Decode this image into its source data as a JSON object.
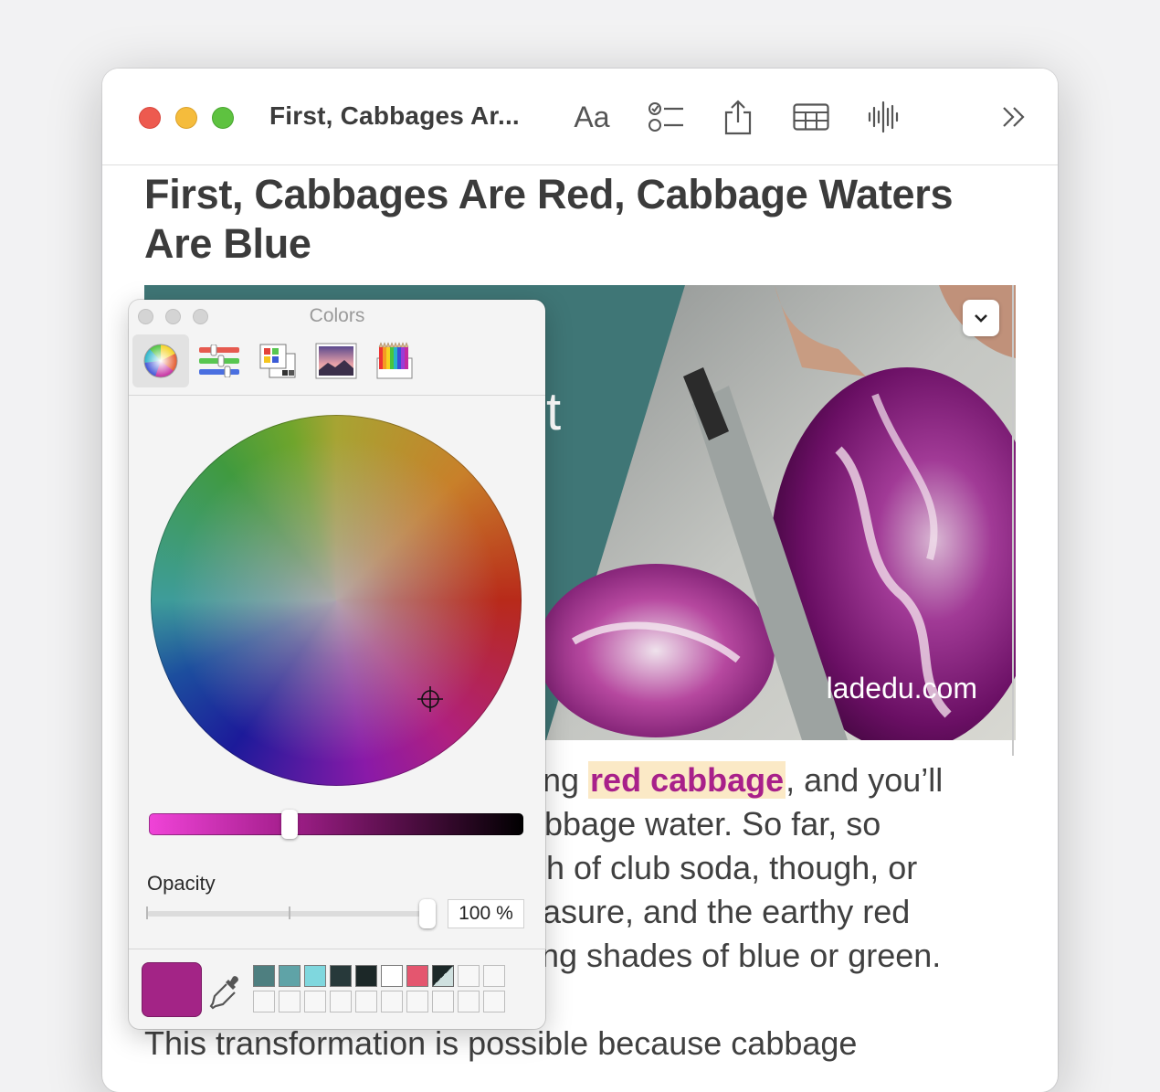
{
  "window": {
    "toolbar_title": "First, Cabbages Ar...",
    "font_button_label": "Aa",
    "more_label": "»"
  },
  "note": {
    "title_line1": "First, Cabbages Are Red, Cabbage Waters",
    "title_line2": "Are Blue",
    "image_caption": "ladedu.com",
    "image_overlay_letter": "t",
    "lines": [
      {
        "before": "ng ",
        "highlight": "red cabbage",
        "after": ", and you’ll"
      },
      {
        "text": "bbage water. So far, so"
      },
      {
        "text": "h of club soda, though, or"
      },
      {
        "text": "asure, and the earthy red"
      },
      {
        "text": "ng shades of blue or green."
      }
    ],
    "next_paragraph": "This transformation is possible because cabbage"
  },
  "colors_panel": {
    "title": "Colors",
    "tabs": [
      "color-wheel",
      "color-sliders",
      "color-palettes",
      "image-palettes",
      "pencils"
    ],
    "active_tab": "color-wheel",
    "opacity_label": "Opacity",
    "opacity_value": "100",
    "opacity_unit": "%",
    "current_color": "#a32486",
    "brightness_level": 0.37,
    "swatches": [
      "#4e7f80",
      "#5fa3a7",
      "#7fd7de",
      "#27393a",
      "#1c2828",
      "#ffffff",
      "#e4566f",
      "diagonal",
      "",
      "",
      "",
      "",
      "",
      "",
      "",
      "",
      "",
      "",
      "",
      ""
    ]
  },
  "colors": {
    "accent_highlight_bg": "#fbe9c6",
    "accent_highlight_text": "#a8208a",
    "hero_teal": "#3f7676"
  }
}
